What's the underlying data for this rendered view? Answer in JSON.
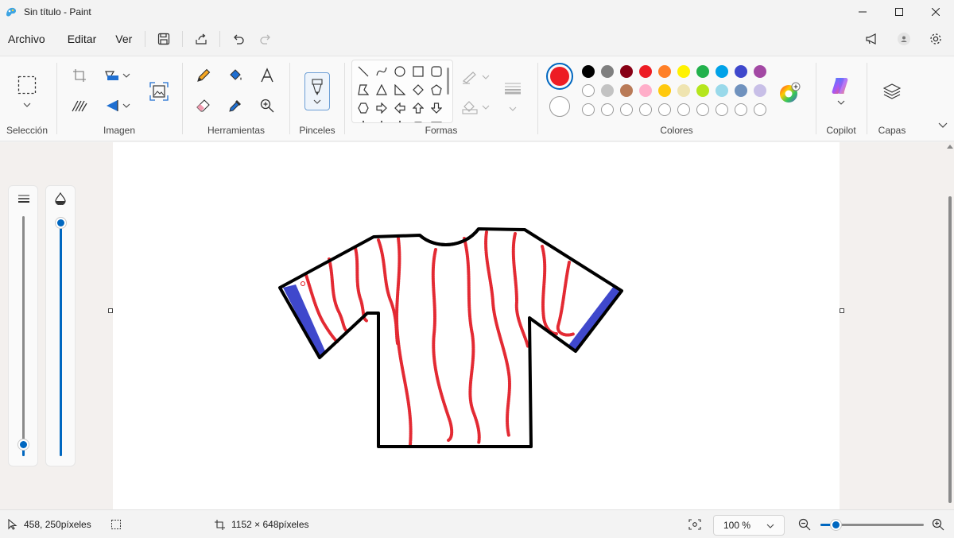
{
  "window": {
    "title": "Sin título - Paint"
  },
  "menu": {
    "file": "Archivo",
    "edit": "Editar",
    "view": "Ver"
  },
  "ribbon": {
    "selection_label": "Selección",
    "image_label": "Imagen",
    "tools_label": "Herramientas",
    "brushes_label": "Pinceles",
    "shapes_label": "Formas",
    "colors_label": "Colores",
    "copilot_label": "Copilot",
    "layers_label": "Capas"
  },
  "colors": {
    "primary": "#ed1c24",
    "secondary": "#ffffff",
    "palette_row1": [
      "#000000",
      "#7f7f7f",
      "#880015",
      "#ed1c24",
      "#ff7f27",
      "#fff200",
      "#22b14c",
      "#00a2e8",
      "#3f48cc",
      "#a349a4"
    ],
    "palette_row2": [
      "#ffffff",
      "#c3c3c3",
      "#b97a57",
      "#ffaec9",
      "#ffc90e",
      "#efe4b0",
      "#b5e61d",
      "#99d9ea",
      "#7092be",
      "#c8bfe7"
    ],
    "accent": "#0067c0"
  },
  "status": {
    "cursor_pos": "458, 250píxeles",
    "canvas_size": "1152 × 648píxeles",
    "zoom": "100 %"
  },
  "sliders": {
    "size_level": 0.05,
    "opacity_level": 1.0
  }
}
